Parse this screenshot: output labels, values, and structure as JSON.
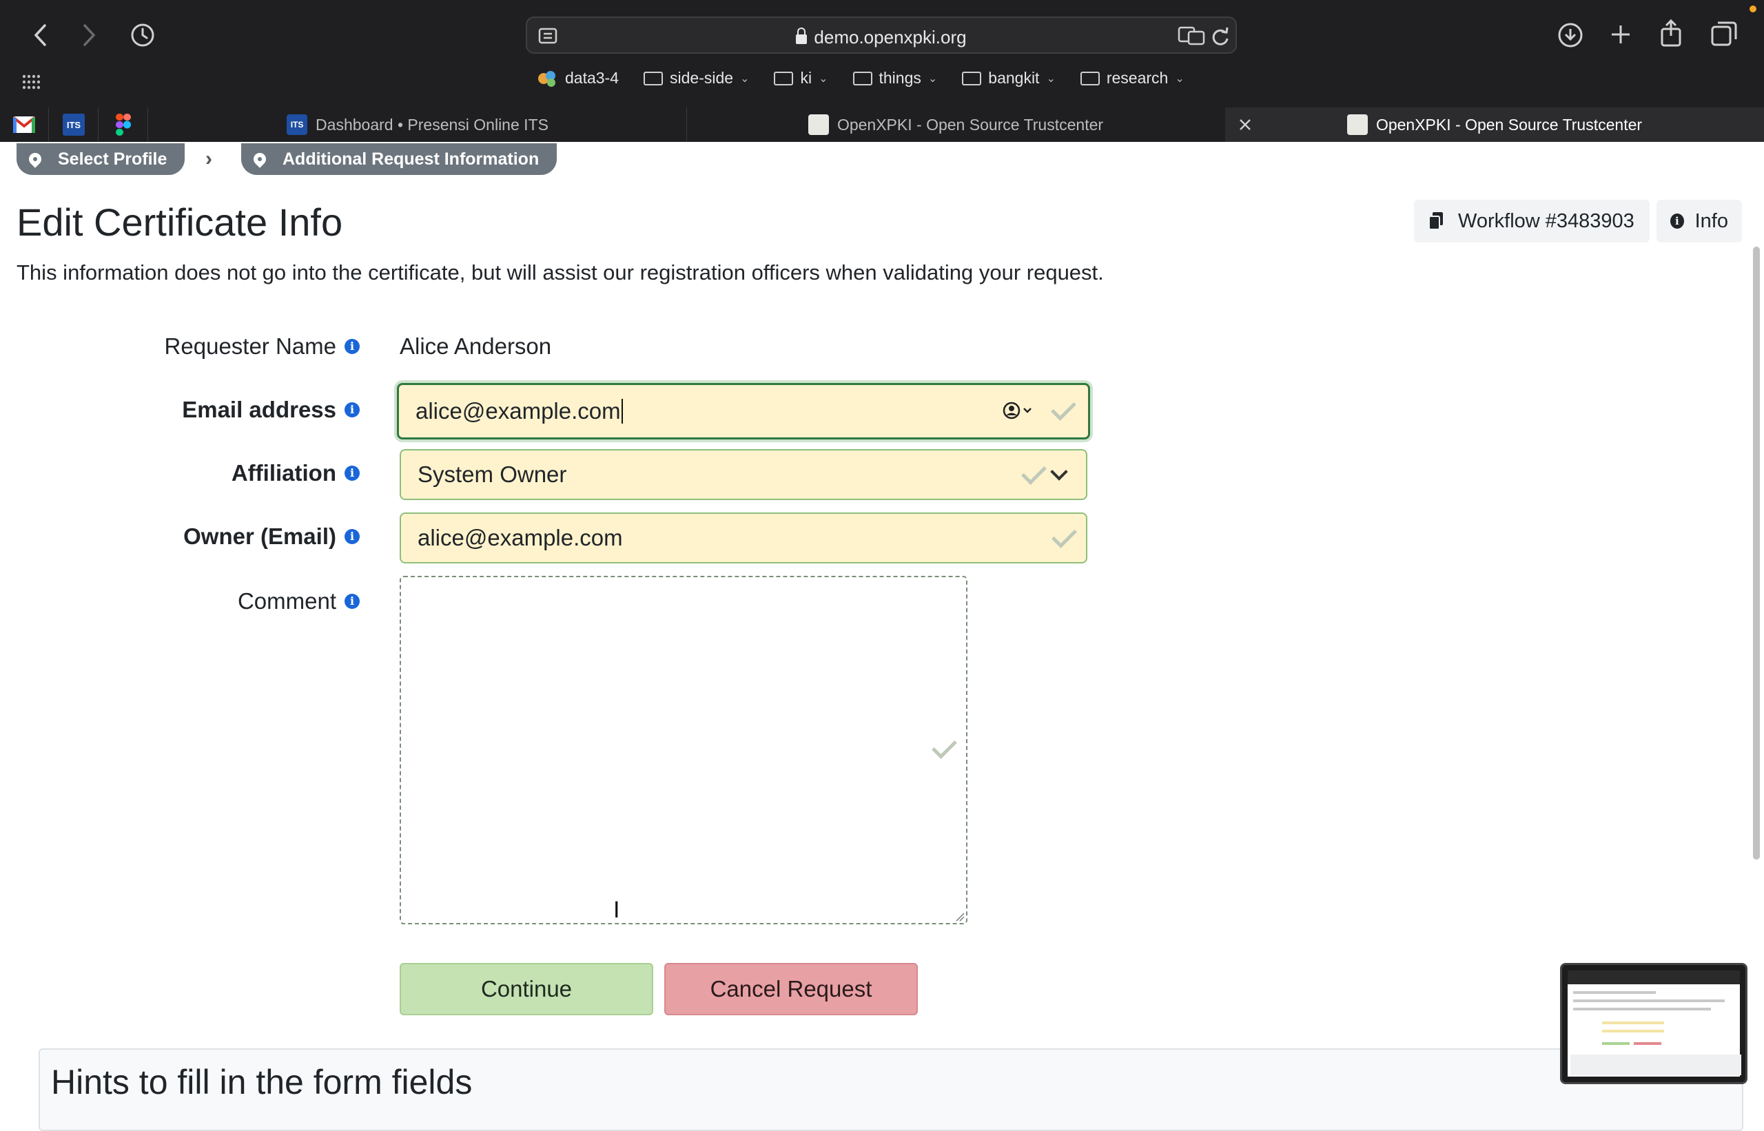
{
  "browser": {
    "url": "demo.openxpki.org",
    "bookmarks": [
      {
        "label": "data3-4"
      },
      {
        "label": "side-side"
      },
      {
        "label": "ki"
      },
      {
        "label": "things"
      },
      {
        "label": "bangkit"
      },
      {
        "label": "research"
      }
    ],
    "tabs": [
      {
        "title": "Dashboard • Presensi Online ITS",
        "favicon_text": "ITS"
      },
      {
        "title": "OpenXPKI - Open Source Trustcenter"
      },
      {
        "title": "OpenXPKI - Open Source Trustcenter"
      }
    ],
    "pinned": [
      "gmail-icon",
      "its-icon",
      "figma-icon"
    ],
    "pinned_its_text": "ITS"
  },
  "breadcrumb": {
    "steps": [
      "Select Profile",
      "Additional Request Information"
    ]
  },
  "page": {
    "title": "Edit Certificate Info",
    "workflow_label": "Workflow #3483903",
    "info_label": "Info",
    "lead": "This information does not go into the certificate, but will assist our registration officers when validating your request."
  },
  "form": {
    "requester_label": "Requester Name",
    "requester_value": "Alice Anderson",
    "email_label": "Email address",
    "email_value": "alice@example.com",
    "affiliation_label": "Affiliation",
    "affiliation_value": "System Owner",
    "owner_label": "Owner (Email)",
    "owner_value": "alice@example.com",
    "comment_label": "Comment",
    "comment_value": "",
    "continue_label": "Continue",
    "cancel_label": "Cancel Request",
    "info_glyph": "i"
  },
  "hints": {
    "title": "Hints to fill in the form fields"
  },
  "colors": {
    "input_bg": "#fff3cd",
    "valid_border": "#2f7a3f",
    "continue": "#c5e2b3",
    "cancel": "#e7a0a4",
    "badge": "#6c757d",
    "info_icon": "#1a66d9"
  }
}
